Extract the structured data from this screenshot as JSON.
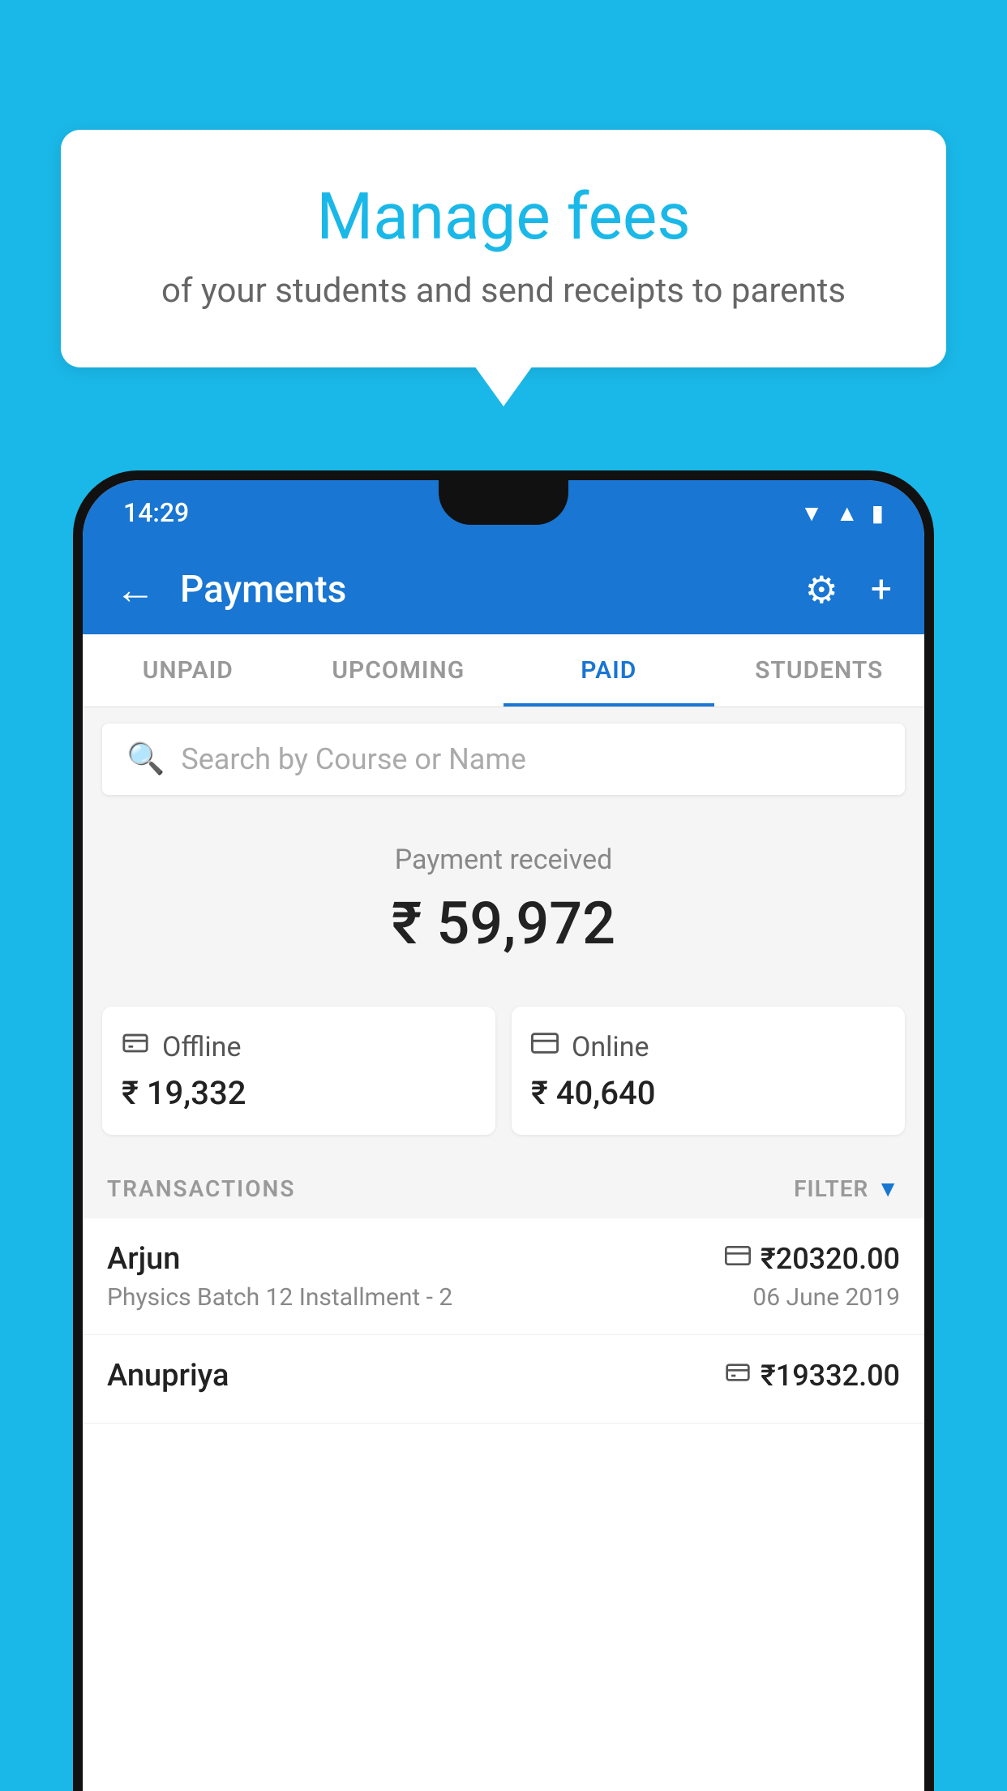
{
  "background_color": "#1ab8e8",
  "tooltip": {
    "title": "Manage fees",
    "subtitle": "of your students and send receipts to parents"
  },
  "status_bar": {
    "time": "14:29",
    "signal_icon": "▲",
    "wifi_icon": "▼",
    "battery_icon": "▮"
  },
  "header": {
    "back_icon": "←",
    "title": "Payments",
    "settings_icon": "⚙",
    "add_icon": "+"
  },
  "tabs": [
    {
      "label": "UNPAID",
      "active": false
    },
    {
      "label": "UPCOMING",
      "active": false
    },
    {
      "label": "PAID",
      "active": true
    },
    {
      "label": "STUDENTS",
      "active": false
    }
  ],
  "search": {
    "placeholder": "Search by Course or Name",
    "search_icon": "🔍"
  },
  "payment_summary": {
    "label": "Payment received",
    "amount": "₹ 59,972",
    "offline": {
      "icon": "₹",
      "label": "Offline",
      "amount": "₹ 19,332"
    },
    "online": {
      "icon": "💳",
      "label": "Online",
      "amount": "₹ 40,640"
    }
  },
  "transactions": {
    "header_label": "TRANSACTIONS",
    "filter_label": "FILTER",
    "items": [
      {
        "name": "Arjun",
        "description": "Physics Batch 12 Installment - 2",
        "amount": "₹20320.00",
        "date": "06 June 2019",
        "payment_type": "online"
      },
      {
        "name": "Anupriya",
        "description": "",
        "amount": "₹19332.00",
        "date": "",
        "payment_type": "offline"
      }
    ]
  }
}
